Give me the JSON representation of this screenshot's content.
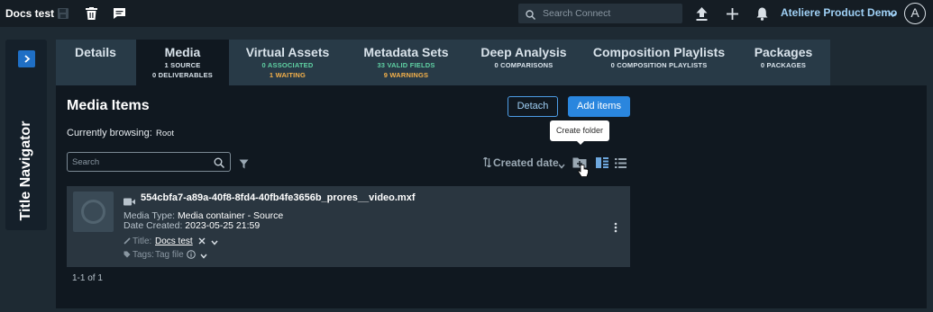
{
  "app_title": "Docs test",
  "search": {
    "placeholder": "Search Connect"
  },
  "workspace": "Ateliere Product Demo",
  "avatar_initial": "A",
  "navigator": {
    "label": "Title Navigator"
  },
  "tabs": [
    {
      "label": "Details",
      "lines": []
    },
    {
      "label": "Media",
      "lines": [
        "1 SOURCE",
        "0 DELIVERABLES"
      ]
    },
    {
      "label": "Virtual Assets",
      "lines": [
        "0 ASSOCIATED",
        "1 WAITING"
      ]
    },
    {
      "label": "Metadata Sets",
      "lines": [
        "33 VALID FIELDS",
        "9 WARNINGS"
      ]
    },
    {
      "label": "Deep Analysis",
      "lines": [
        "0 COMPARISONS"
      ]
    },
    {
      "label": "Composition Playlists",
      "lines": [
        "0 COMPOSITION PLAYLISTS"
      ]
    },
    {
      "label": "Packages",
      "lines": [
        "0 PACKAGES"
      ]
    }
  ],
  "colors": {
    "accent": "#2a86de",
    "success": "#5fd0a3",
    "warning": "#f5b14a",
    "background": "#101820"
  },
  "main": {
    "title": "Media Items",
    "browsing_label": "Currently browsing:",
    "browsing_value": "Root",
    "detach_label": "Detach",
    "add_items_label": "Add items",
    "tooltip": "Create folder",
    "filter_placeholder": "Search",
    "sort_label": "Created date"
  },
  "item": {
    "filename": "554cbfa7-a89a-40f8-8fd4-40fb4fe3656b_prores__video.mxf",
    "media_type_label": "Media Type:",
    "media_type": "Media container - Source",
    "date_label": "Date Created:",
    "date": "2023-05-25 21:59",
    "title_label": "Title:",
    "title": "Docs test",
    "tags_label": "Tags:",
    "tags": "Tag file"
  },
  "pagination": "1-1 of 1"
}
